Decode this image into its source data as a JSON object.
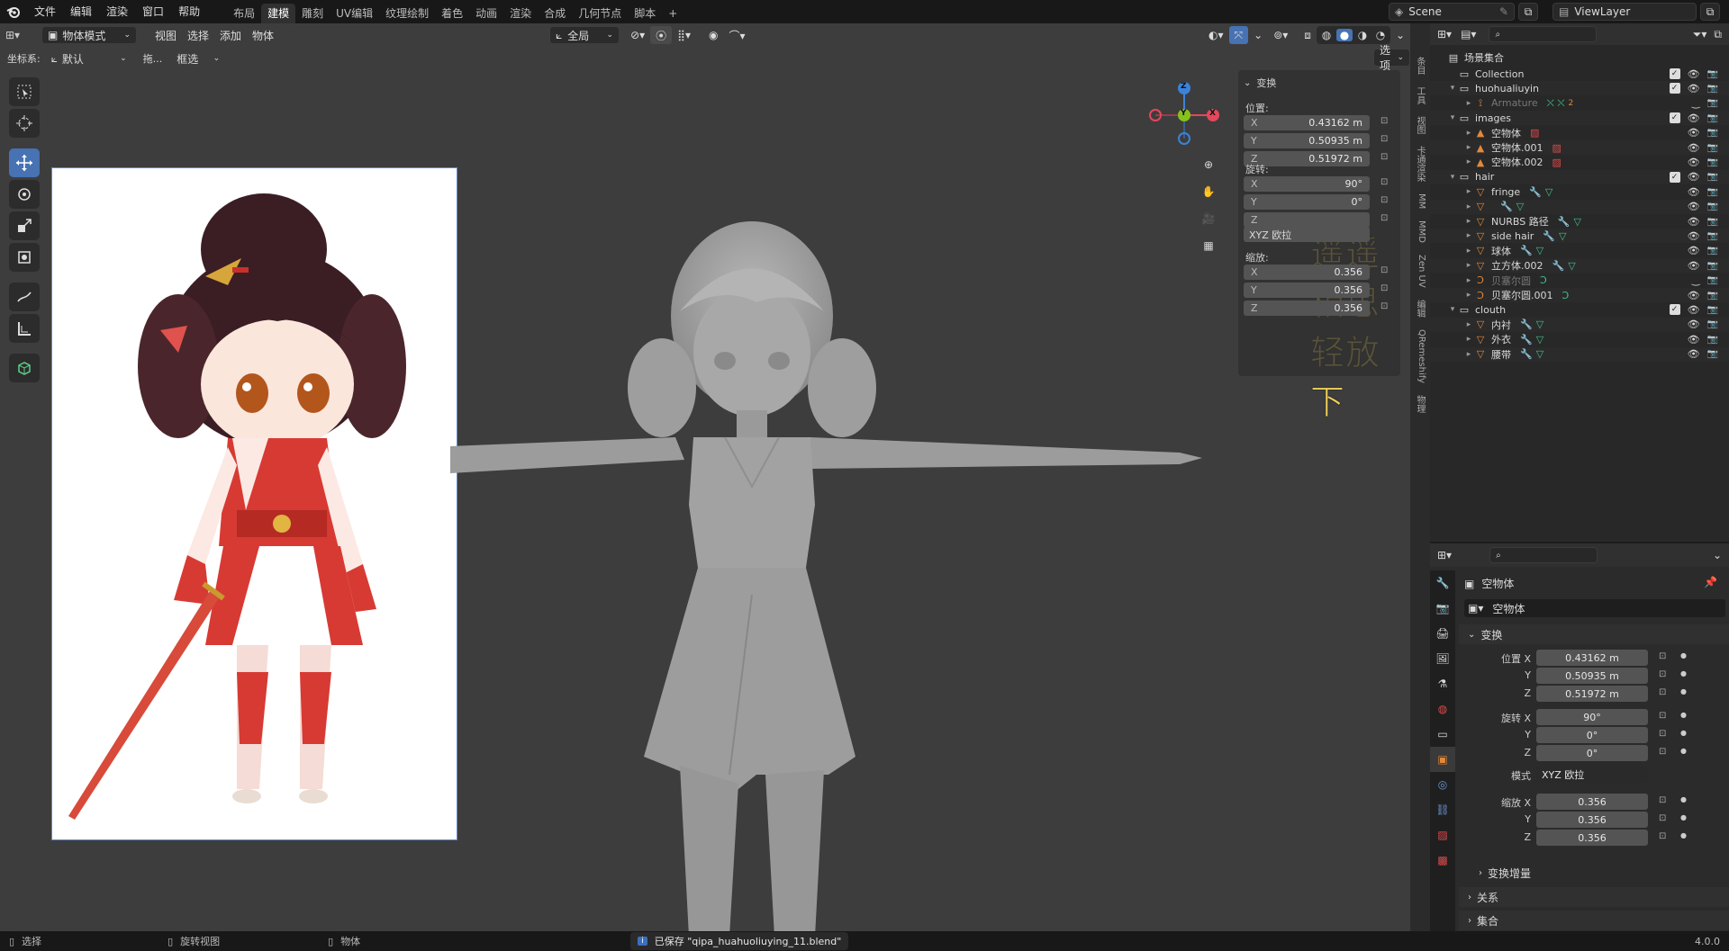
{
  "topbar": {
    "menus": [
      "文件",
      "编辑",
      "渲染",
      "窗口",
      "帮助"
    ],
    "workspaces": [
      "布局",
      "建模",
      "雕刻",
      "UV编辑",
      "纹理绘制",
      "着色",
      "动画",
      "渲染",
      "合成",
      "几何节点",
      "脚本"
    ],
    "active_workspace_index": 1,
    "add_workspace": "+",
    "scene": "Scene",
    "view_layer": "ViewLayer"
  },
  "viewport_header": {
    "mode": "物体模式",
    "menus": [
      "视图",
      "选择",
      "添加",
      "物体"
    ],
    "orientation": "全局",
    "options_label": "选项",
    "coord_label": "坐标系:",
    "coord_value": "默认",
    "drag_label": "拖...",
    "select_box": "框选"
  },
  "gizmo": {
    "x": "X",
    "y": "Y",
    "z": "Z"
  },
  "overlay_caption": "遥遥相思轻放下",
  "npanel": {
    "section": "变换",
    "location_label": "位置:",
    "location": [
      {
        "k": "X",
        "v": "0.43162 m"
      },
      {
        "k": "Y",
        "v": "0.50935 m"
      },
      {
        "k": "Z",
        "v": "0.51972 m"
      }
    ],
    "rotation_label": "旋转:",
    "rotation": [
      {
        "k": "X",
        "v": "90°"
      },
      {
        "k": "Y",
        "v": "0°"
      },
      {
        "k": "Z",
        "v": ""
      }
    ],
    "rotation_mode": "XYZ 欧拉",
    "scale_label": "缩放:",
    "scale": [
      {
        "k": "X",
        "v": "0.356"
      },
      {
        "k": "Y",
        "v": "0.356"
      },
      {
        "k": "Z",
        "v": "0.356"
      }
    ]
  },
  "side_tabs": [
    "条目",
    "工具",
    "视图",
    "卡通渲染",
    "MM",
    "MMD",
    "Zen UV",
    "编辑",
    "QRemeshify",
    "物理"
  ],
  "outliner": {
    "root": "场景集合",
    "rows": [
      {
        "name": "Collection",
        "indent": 0,
        "type": "collection",
        "tri": "",
        "check": true
      },
      {
        "name": "huohualiuyin",
        "indent": 0,
        "type": "collection",
        "tri": "▾",
        "check": true
      },
      {
        "name": "Armature",
        "indent": 1,
        "type": "armature",
        "tri": "▸",
        "dim": true,
        "sub": "2"
      },
      {
        "name": "images",
        "indent": 0,
        "type": "collection",
        "tri": "▾",
        "check": true
      },
      {
        "name": "空物体",
        "indent": 1,
        "type": "image",
        "tri": "▸"
      },
      {
        "name": "空物体.001",
        "indent": 1,
        "type": "image",
        "tri": "▸"
      },
      {
        "name": "空物体.002",
        "indent": 1,
        "type": "image",
        "tri": "▸"
      },
      {
        "name": "hair",
        "indent": 0,
        "type": "collection",
        "tri": "▾",
        "check": true
      },
      {
        "name": "fringe",
        "indent": 1,
        "type": "mesh",
        "tri": "▸"
      },
      {
        "name": "",
        "indent": 1,
        "type": "mesh",
        "tri": "▸"
      },
      {
        "name": "NURBS 路径",
        "indent": 1,
        "type": "mesh",
        "tri": "▸"
      },
      {
        "name": "side hair",
        "indent": 1,
        "type": "mesh",
        "tri": "▸"
      },
      {
        "name": "球体",
        "indent": 1,
        "type": "mesh",
        "tri": "▸"
      },
      {
        "name": "立方体.002",
        "indent": 1,
        "type": "mesh",
        "tri": "▸"
      },
      {
        "name": "贝塞尔圆",
        "indent": 1,
        "type": "curve",
        "tri": "▸",
        "dim": true
      },
      {
        "name": "贝塞尔圆.001",
        "indent": 1,
        "type": "curve",
        "tri": "▸"
      },
      {
        "name": "clouth",
        "indent": 0,
        "type": "collection",
        "tri": "▾",
        "check": true
      },
      {
        "name": "内衬",
        "indent": 1,
        "type": "mesh",
        "tri": "▸"
      },
      {
        "name": "外衣",
        "indent": 1,
        "type": "mesh",
        "tri": "▸"
      },
      {
        "name": "腰带",
        "indent": 1,
        "type": "mesh",
        "tri": "▸"
      }
    ]
  },
  "properties": {
    "object_name": "空物体",
    "data_name": "空物体",
    "section": "变换",
    "loc_x_label": "位置 X",
    "loc_x": "0.43162 m",
    "loc_y_label": "Y",
    "loc_y": "0.50935 m",
    "loc_z_label": "Z",
    "loc_z": "0.51972 m",
    "rot_x_label": "旋转 X",
    "rot_x": "90°",
    "rot_y_label": "Y",
    "rot_y": "0°",
    "rot_z_label": "Z",
    "rot_z": "0°",
    "mode_label": "模式",
    "mode": "XYZ 欧拉",
    "scale_x_label": "缩放 X",
    "scale_x": "0.356",
    "scale_y_label": "Y",
    "scale_y": "0.356",
    "scale_z_label": "Z",
    "scale_z": "0.356",
    "delta": "变换增量",
    "relations": "关系",
    "collections": "集合"
  },
  "statusbar": {
    "select": "选择",
    "rotate": "旋转视图",
    "object": "物体",
    "saved": "已保存 \"qipa_huahuoliuying_11.blend\"",
    "version": "4.0.0"
  },
  "colors": {
    "accent": "#4772b3",
    "axis_x": "#e6475c",
    "axis_y": "#86c21d",
    "axis_z": "#3c82d9",
    "object_orange": "#e2883c",
    "modifier_blue": "#6e9ad5",
    "mesh_green": "#3fc28a"
  }
}
